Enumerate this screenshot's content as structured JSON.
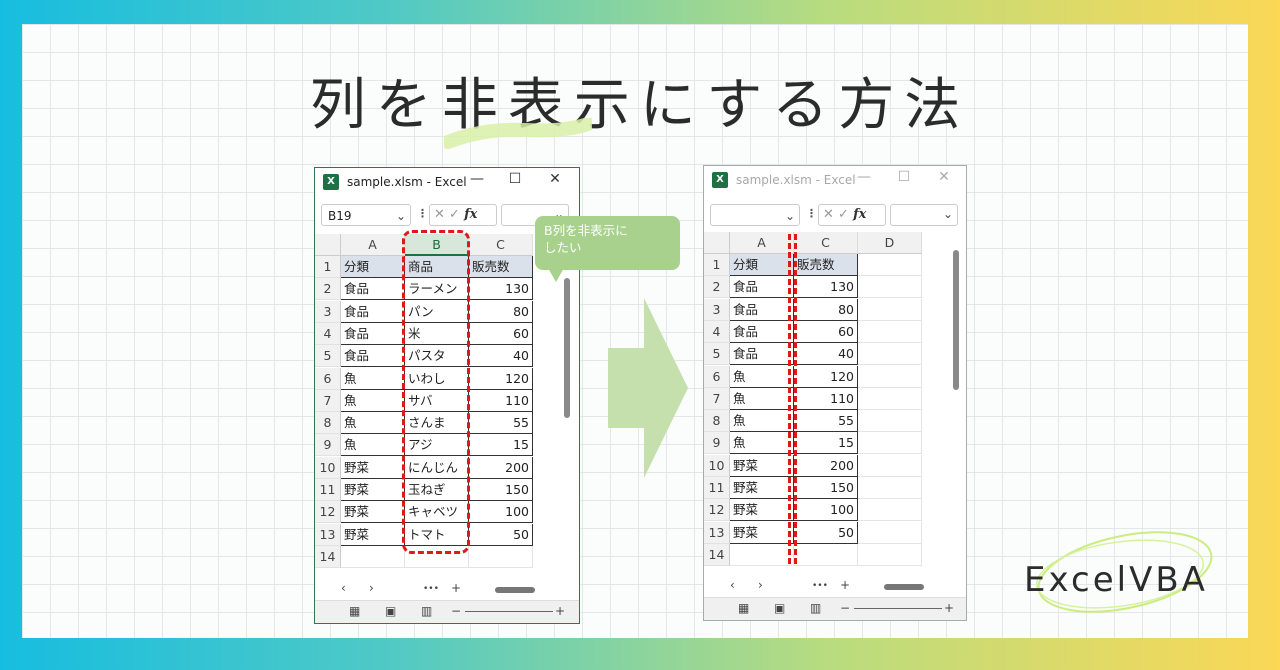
{
  "title": "列を非表示にする方法",
  "brand": "ExcelVBA",
  "colors": {
    "excel_green": "#1e7145",
    "highlight_red": "#e01818",
    "callout_green": "#a8d18d",
    "header_fill": "#dbe1ea"
  },
  "callout": {
    "line1": "B列を非表示に",
    "line2": "したい"
  },
  "window_before": {
    "title": "sample.xlsm - Excel",
    "name_box": "B19",
    "columns": [
      "A",
      "B",
      "C"
    ],
    "selected_column": "B",
    "rows": [
      "1",
      "2",
      "3",
      "4",
      "5",
      "6",
      "7",
      "8",
      "9",
      "10",
      "11",
      "12",
      "13",
      "14"
    ],
    "table": [
      [
        "分類",
        "商品",
        "販売数"
      ],
      [
        "食品",
        "ラーメン",
        "130"
      ],
      [
        "食品",
        "パン",
        "80"
      ],
      [
        "食品",
        "米",
        "60"
      ],
      [
        "食品",
        "パスタ",
        "40"
      ],
      [
        "魚",
        "いわし",
        "120"
      ],
      [
        "魚",
        "サバ",
        "110"
      ],
      [
        "魚",
        "さんま",
        "55"
      ],
      [
        "魚",
        "アジ",
        "15"
      ],
      [
        "野菜",
        "にんじん",
        "200"
      ],
      [
        "野菜",
        "玉ねぎ",
        "150"
      ],
      [
        "野菜",
        "キャベツ",
        "100"
      ],
      [
        "野菜",
        "トマト",
        "50"
      ]
    ]
  },
  "window_after": {
    "title": "sample.xlsm - Excel",
    "name_box": "",
    "columns": [
      "A",
      "C",
      "D"
    ],
    "rows": [
      "1",
      "2",
      "3",
      "4",
      "5",
      "6",
      "7",
      "8",
      "9",
      "10",
      "11",
      "12",
      "13",
      "14"
    ],
    "table": [
      [
        "分類",
        "販売数"
      ],
      [
        "食品",
        "130"
      ],
      [
        "食品",
        "80"
      ],
      [
        "食品",
        "60"
      ],
      [
        "食品",
        "40"
      ],
      [
        "魚",
        "120"
      ],
      [
        "魚",
        "110"
      ],
      [
        "魚",
        "55"
      ],
      [
        "魚",
        "15"
      ],
      [
        "野菜",
        "200"
      ],
      [
        "野菜",
        "150"
      ],
      [
        "野菜",
        "100"
      ],
      [
        "野菜",
        "50"
      ]
    ]
  },
  "icons": {
    "minimize": "—",
    "maximize": "☐",
    "close": "✕",
    "dropdown": "⌄",
    "cancel": "✕",
    "enter": "✓",
    "fx": "fx",
    "prev_sheet": "‹",
    "next_sheet": "›",
    "more": "•••",
    "add_sheet": "+",
    "normal_view": "▦",
    "page_layout": "▣",
    "page_break": "▥",
    "zoom_minus": "−",
    "zoom_plus": "+"
  }
}
